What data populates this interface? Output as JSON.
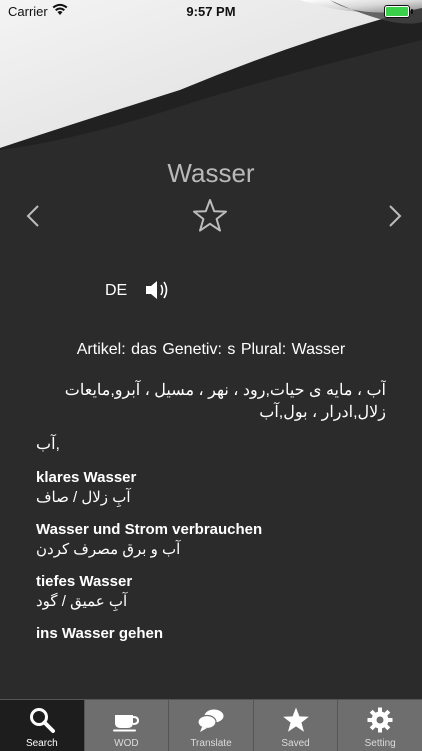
{
  "status": {
    "carrier": "Carrier",
    "time": "9:57 PM",
    "battery_color": "#3ad04a"
  },
  "entry": {
    "word": "Wasser",
    "lang_code": "DE",
    "grammar": "Artikel: das   Genetiv: s   Plural: Wasser",
    "translation_lines": [
      "آب ، مایه ی حیات,رود ، نهر ، مسیل ، آبرو,مایعات",
      "زلال,ادرار ، بول,آب",
      "آب,"
    ],
    "examples": [
      {
        "de": "klares Wasser",
        "fa": "آبِ زلال / صاف"
      },
      {
        "de": "Wasser und Strom verbrauchen",
        "fa": "آب و برق مصرف کردن"
      },
      {
        "de": "tiefes Wasser",
        "fa": "آبِ عمیق / گود"
      },
      {
        "de": "ins Wasser gehen",
        "fa": ""
      }
    ]
  },
  "tabs": [
    {
      "label": "Search",
      "icon": "search-icon"
    },
    {
      "label": "WOD",
      "icon": "cup-icon"
    },
    {
      "label": "Translate",
      "icon": "chat-bubbles-icon"
    },
    {
      "label": "Saved",
      "icon": "star-icon"
    },
    {
      "label": "Setting",
      "icon": "gear-icon"
    }
  ],
  "colors": {
    "background": "#2b2b2b",
    "tabbar": "#6e6e6e",
    "active_tab": "#1d1d1d"
  }
}
